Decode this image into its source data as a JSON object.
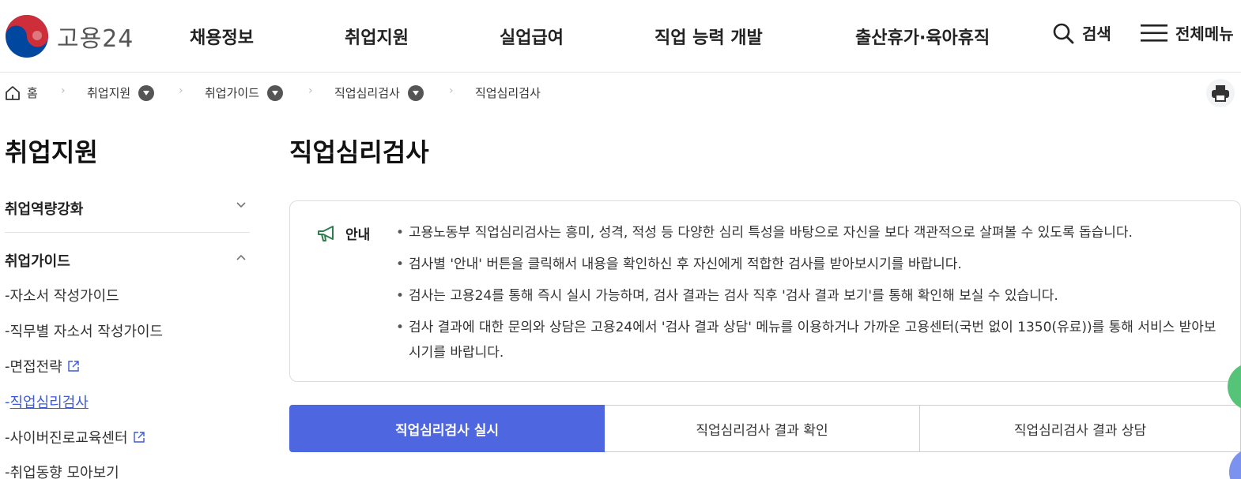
{
  "header": {
    "logo_text": "고용24",
    "gnb": [
      "채용정보",
      "취업지원",
      "실업급여",
      "직업 능력 개발",
      "출산휴가·육아휴직"
    ],
    "search_label": "검색",
    "menu_label": "전체메뉴"
  },
  "breadcrumb": {
    "items": [
      "홈",
      "취업지원",
      "취업가이드",
      "직업심리검사",
      "직업심리검사"
    ]
  },
  "sidebar": {
    "title": "취업지원",
    "groups": [
      "취업역량강화",
      "취업가이드"
    ],
    "sub_items": [
      "자소서 작성가이드",
      "직무별 자소서 작성가이드",
      "면접전략",
      "직업심리검사",
      "사이버진로교육센터",
      "취업동향 모아보기"
    ]
  },
  "main": {
    "title": "직업심리검사",
    "notice": {
      "label": "안내",
      "items": [
        "고용노동부 직업심리검사는 흥미, 성격, 적성 등 다양한 심리 특성을 바탕으로 자신을 보다 객관적으로 살펴볼 수 있도록 돕습니다.",
        "검사별 '안내' 버튼을 클릭해서 내용을 확인하신 후 자신에게 적합한 검사를 받아보시기를 바랍니다.",
        "검사는 고용24를 통해 즉시 실시 가능하며, 검사 결과는 검사 직후 '검사 결과 보기'를 통해 확인해 보실 수 있습니다.",
        "검사 결과에 대한 문의와 상담은 고용24에서 '검사 결과 상담' 메뉴를 이용하거나 가까운 고용센터(국번 없이 1350(유료))를 통해 서비스 받아보시기를 바랍니다."
      ]
    },
    "tabs": [
      "직업심리검사 실시",
      "직업심리검사 결과 확인",
      "직업심리검사 결과 상담"
    ]
  },
  "colors": {
    "accent": "#4e66e0",
    "active_link": "#3c5bd6",
    "notice_icon": "#2e7d4f",
    "logo_red": "#cd2e3a",
    "logo_blue": "#0047a0"
  },
  "icons": [
    "logo-emblem-icon",
    "search-icon",
    "hamburger-icon",
    "home-icon",
    "chevron-right-icon",
    "dropdown-icon",
    "print-icon",
    "chevron-down-icon",
    "chevron-up-icon",
    "external-link-icon",
    "megaphone-icon"
  ]
}
